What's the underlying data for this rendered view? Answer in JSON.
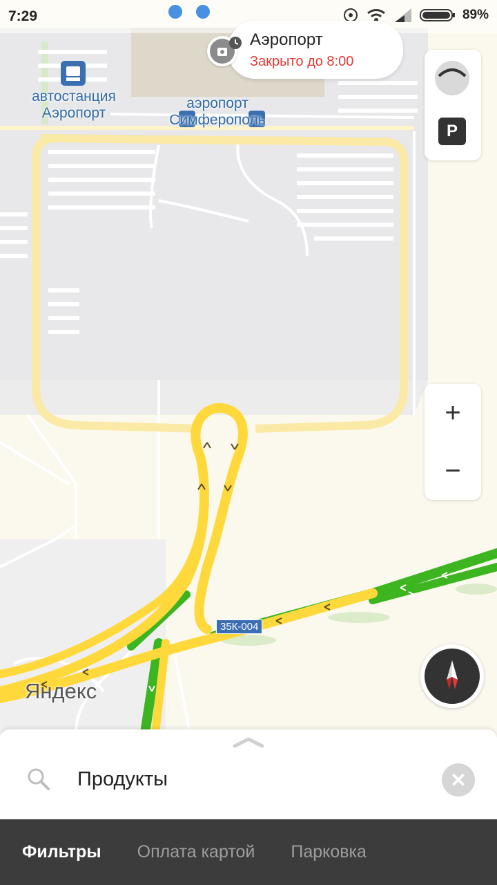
{
  "status_bar": {
    "time": "7:29",
    "battery": "89%"
  },
  "poi": {
    "title": "Аэропорт",
    "status": "Закрыто до 8:00"
  },
  "map_labels": {
    "bus_station": "автостанция\nАэропорт",
    "airport": "аэропорт\nСимферополь"
  },
  "road_badge": "35К-004",
  "logo": "Яндекс",
  "layers": {
    "parking_label": "P"
  },
  "zoom": {
    "in": "+",
    "out": "−"
  },
  "search": {
    "value": "Продукты"
  },
  "filters": {
    "items": [
      "Фильтры",
      "Оплата картой",
      "Парковка"
    ]
  },
  "colors": {
    "traffic_jam": "#ffd93b",
    "traffic_free": "#3cb521",
    "road": "#fbe9a6",
    "alert": "#e53935",
    "label": "#2f6aa6"
  }
}
